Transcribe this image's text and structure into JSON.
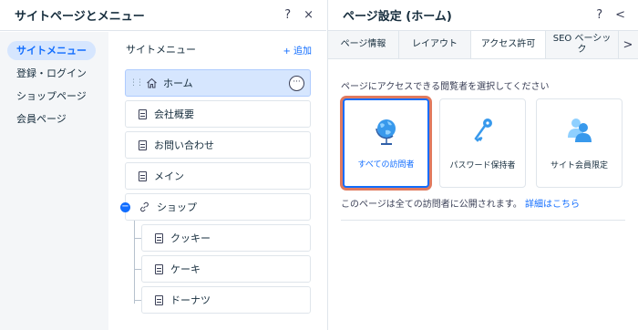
{
  "left_panel": {
    "title": "サイトページとメニュー",
    "help": "?",
    "close": "×",
    "nav": [
      {
        "label": "サイトメニュー",
        "active": true
      },
      {
        "label": "登録・ログイン",
        "active": false
      },
      {
        "label": "ショップページ",
        "active": false
      },
      {
        "label": "会員ページ",
        "active": false
      }
    ],
    "menu_title": "サイトメニュー",
    "add_label": "+ 追加",
    "menu_items": [
      {
        "label": "ホーム"
      },
      {
        "label": "会社概要"
      },
      {
        "label": "お問い合わせ"
      },
      {
        "label": "メイン"
      },
      {
        "label": "ショップ"
      },
      {
        "label": "クッキー"
      },
      {
        "label": "ケーキ"
      },
      {
        "label": "ドーナツ"
      }
    ],
    "more": "···",
    "collapse": "−"
  },
  "right_panel": {
    "title": "ページ設定 (ホーム)",
    "help": "?",
    "back": "<",
    "tabs": [
      "ページ情報",
      "レイアウト",
      "アクセス許可",
      "SEO ベーシック"
    ],
    "tabs_next": ">",
    "section_label": "ページにアクセスできる閲覧者を選択してください",
    "cards": [
      {
        "label": "すべての訪問者",
        "icon": "globe-icon",
        "selected": true
      },
      {
        "label": "パスワード保持者",
        "icon": "key-icon",
        "selected": false
      },
      {
        "label": "サイト会員限定",
        "icon": "members-icon",
        "selected": false
      }
    ],
    "footer_text": "このページは全ての訪問者に公開されます。",
    "learn_more": "詳細はこちら"
  },
  "colors": {
    "accent": "#116dff",
    "highlight_outline": "#e07a5f",
    "icon_blue": "#3899ec"
  }
}
